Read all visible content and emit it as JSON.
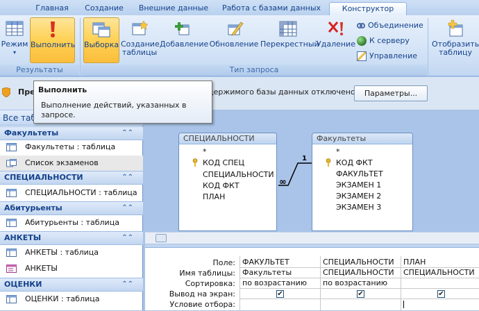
{
  "tabs": [
    "Главная",
    "Создание",
    "Внешние данные",
    "Работа с базами данных",
    "Конструктор"
  ],
  "ribbon": {
    "results_group": "Результаты",
    "query_type_group": "Тип запроса",
    "btn_view": "Режим",
    "btn_run": "Выполнить",
    "btn_select": "Выборка",
    "btn_make_table_1": "Создание",
    "btn_make_table_2": "таблицы",
    "btn_append": "Добавление",
    "btn_update": "Обновление",
    "btn_crosstab": "Перекрестный",
    "btn_delete": "Удаление",
    "btn_union": "Объединение",
    "btn_passthrough": "К серверу",
    "btn_ddl": "Управление",
    "btn_show_table_1": "Отобразить",
    "btn_show_table_2": "таблицу"
  },
  "message_bar": {
    "prefix": "Пре",
    "text": "держимого базы данных отключено",
    "button": "Параметры..."
  },
  "tooltip": {
    "title": "Выполнить",
    "body": "Выполнение действий, указанных в запросе."
  },
  "nav": {
    "header": "Все табл",
    "groups": [
      {
        "title": "Факультеты",
        "items": [
          {
            "label": "Факультеты : таблица",
            "icon": "table-icon"
          },
          {
            "label": "Список экзаменов",
            "icon": "query-icon",
            "selected": true
          }
        ]
      },
      {
        "title": "СПЕЦИАЛЬНОСТИ",
        "items": [
          {
            "label": "СПЕЦИАЛЬНОСТИ : таблица",
            "icon": "table-icon"
          }
        ]
      },
      {
        "title": "Абитурьенты",
        "items": [
          {
            "label": "Абитурьенты : таблица",
            "icon": "table-icon"
          }
        ]
      },
      {
        "title": "АНКЕТЫ",
        "items": [
          {
            "label": "АНКЕТЫ : таблица",
            "icon": "table-icon"
          },
          {
            "label": "АНКЕТЫ",
            "icon": "form-icon"
          }
        ]
      },
      {
        "title": "ОЦЕНКИ",
        "items": [
          {
            "label": "ОЦЕНКИ : таблица",
            "icon": "table-icon"
          }
        ]
      }
    ]
  },
  "tables": [
    {
      "title": "СПЕЦИАЛЬНОСТИ",
      "fields": [
        "*",
        "КОД СПЕЦ",
        "СПЕЦИАЛЬНОСТИ",
        "КОД ФКТ",
        "ПЛАН"
      ],
      "key_index": 1
    },
    {
      "title": "Факультеты",
      "fields": [
        "*",
        "КОД ФКТ",
        "ФАКУЛЬТЕТ",
        "ЭКЗАМЕН 1",
        "ЭКЗАМЕН 2",
        "ЭКЗАМЕН 3"
      ],
      "key_index": 1
    }
  ],
  "relation": {
    "many": "∞",
    "one": "1"
  },
  "grid": {
    "row_labels": [
      "Поле:",
      "Имя таблицы:",
      "Сортировка:",
      "Вывод на экран:",
      "Условие отбора:"
    ],
    "columns": [
      {
        "field": "ФАКУЛЬТЕТ",
        "table": "Факультеты",
        "sort": "по возрастанию",
        "show": true,
        "criteria": ""
      },
      {
        "field": "СПЕЦИАЛЬНОСТИ",
        "table": "СПЕЦИАЛЬНОСТИ",
        "sort": "по возрастанию",
        "show": true,
        "criteria": ""
      },
      {
        "field": "ПЛАН",
        "table": "СПЕЦИАЛЬНОСТИ",
        "sort": "",
        "show": true,
        "criteria": ""
      }
    ]
  }
}
